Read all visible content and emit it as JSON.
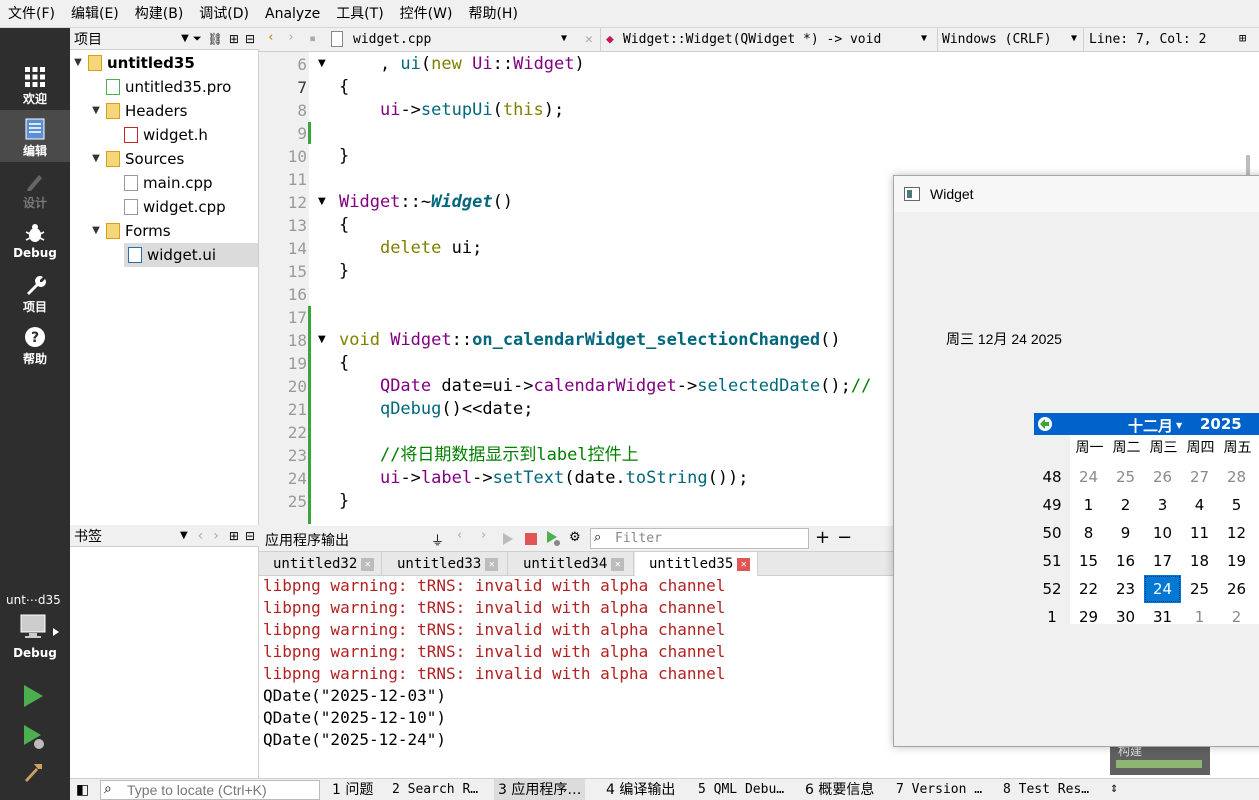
{
  "menu": [
    "文件(F)",
    "编辑(E)",
    "构建(B)",
    "调试(D)",
    "Analyze",
    "工具(T)",
    "控件(W)",
    "帮助(H)"
  ],
  "modes": [
    {
      "label": "欢迎",
      "icon": "grid-icon"
    },
    {
      "label": "编辑",
      "icon": "edit-icon"
    },
    {
      "label": "设计",
      "icon": "pen-icon"
    },
    {
      "label": "Debug",
      "icon": "bug-icon"
    },
    {
      "label": "项目",
      "icon": "wrench-icon"
    },
    {
      "label": "帮助",
      "icon": "help-icon"
    }
  ],
  "kit": {
    "project": "unt⋯d35",
    "mode": "Debug"
  },
  "projects_panel": {
    "title": "项目",
    "tree": [
      "untitled35",
      "untitled35.pro",
      "Headers",
      "widget.h",
      "Sources",
      "main.cpp",
      "widget.cpp",
      "Forms",
      "widget.ui"
    ]
  },
  "bookmarks_panel": {
    "title": "书签"
  },
  "editor": {
    "file": "widget.cpp",
    "symbol": "Widget::Widget(QWidget *) -> void",
    "encoding": "Windows (CRLF)",
    "position": "Line: 7, Col: 2",
    "line_numbers": [
      "6",
      "7",
      "8",
      "9",
      "10",
      "11",
      "12",
      "13",
      "14",
      "15",
      "16",
      "17",
      "18",
      "19",
      "20",
      "21",
      "22",
      "23",
      "24",
      "25"
    ],
    "comment_23": "//将日期数据显示到label控件上"
  },
  "output": {
    "title": "应用程序输出",
    "filter_placeholder": "Filter",
    "tabs": [
      "untitled32",
      "untitled33",
      "untitled34",
      "untitled35"
    ],
    "lines": [
      "libpng warning: tRNS: invalid with alpha channel",
      "libpng warning: tRNS: invalid with alpha channel",
      "libpng warning: tRNS: invalid with alpha channel",
      "libpng warning: tRNS: invalid with alpha channel",
      "libpng warning: tRNS: invalid with alpha channel",
      "QDate(\"2025-12-03\")",
      "QDate(\"2025-12-10\")",
      "QDate(\"2025-12-24\")"
    ]
  },
  "widget": {
    "title": "Widget",
    "label": "周三 12月 24 2025",
    "calendar": {
      "month": "十二月",
      "year": "2025",
      "weekdays": [
        "周一",
        "周二",
        "周三",
        "周四",
        "周五"
      ],
      "weeks": [
        "48",
        "49",
        "50",
        "51",
        "52",
        "1"
      ],
      "days": [
        [
          "24",
          "25",
          "26",
          "27",
          "28"
        ],
        [
          "1",
          "2",
          "3",
          "4",
          "5"
        ],
        [
          "8",
          "9",
          "10",
          "11",
          "12"
        ],
        [
          "15",
          "16",
          "17",
          "18",
          "19"
        ],
        [
          "22",
          "23",
          "24",
          "25",
          "26"
        ],
        [
          "29",
          "30",
          "31",
          "1",
          "2"
        ]
      ],
      "selected": "24"
    },
    "build_hint": "构建"
  },
  "statusbar": {
    "locator_placeholder": "Type to locate (Ctrl+K)",
    "items": [
      "1 问题",
      "2 Search R…",
      "3 应用程序…",
      "4 编译输出",
      "5 QML Debu…",
      "6 概要信息",
      "7 Version …",
      "8 Test Res…"
    ]
  }
}
